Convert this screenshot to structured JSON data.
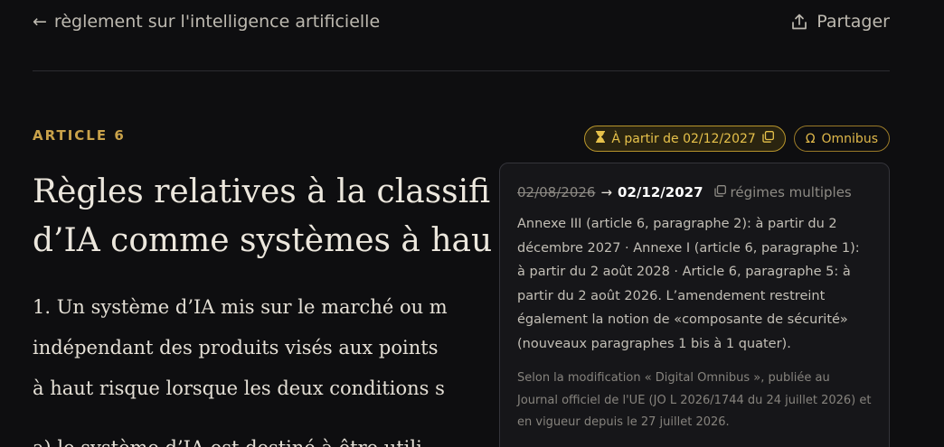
{
  "header": {
    "back_arrow": "←",
    "back_label": "règlement sur l'intelligence artificielle",
    "share_label": "Partager"
  },
  "article": {
    "number": "ARTICLE 6",
    "title_lines": [
      "Règles relatives à la classifi",
      "d’IA comme systèmes à hau"
    ],
    "paragraph_lines": [
      "1.  Un système d’IA mis sur le marché ou m",
      "indépendant des produits visés aux points",
      "à haut risque lorsque les deux conditions s"
    ],
    "next_line": "a)  le système d’IA est destiné à être utili"
  },
  "badges": {
    "date_label": "À partir de 02/12/2027",
    "omnibus_label": "Omnibus"
  },
  "tooltip": {
    "old_date": "02/08/2026",
    "arrow": "→",
    "new_date": "02/12/2027",
    "regimes_label": "régimes multiples",
    "body": "Annexe III (article 6, paragraphe 2): à partir du 2 décembre 2027 · Annexe I (article 6, paragraphe 1): à partir du 2 août 2028 · Article 6, paragraphe 5: à partir du 2 août 2026. L’amendement restreint également la notion de «composante de sécurité» (nouveaux paragraphes 1 bis à 1 quater).",
    "source": "Selon la modification « Digital Omnibus », publiée au Journal officiel de l'UE (JO L 2026/1744 du 24 juillet 2026) et en vigueur depuis le 27 juillet 2026."
  },
  "colors": {
    "background": "#0e0e10",
    "accent_gold": "#c9a24a",
    "badge_border": "#b8952c",
    "tooltip_bg": "#161619"
  },
  "icons": {
    "back": "arrow-left-icon",
    "share": "share-upload-icon",
    "hourglass": "hourglass-icon",
    "copy": "copy-icon",
    "omega": "omega-icon"
  }
}
